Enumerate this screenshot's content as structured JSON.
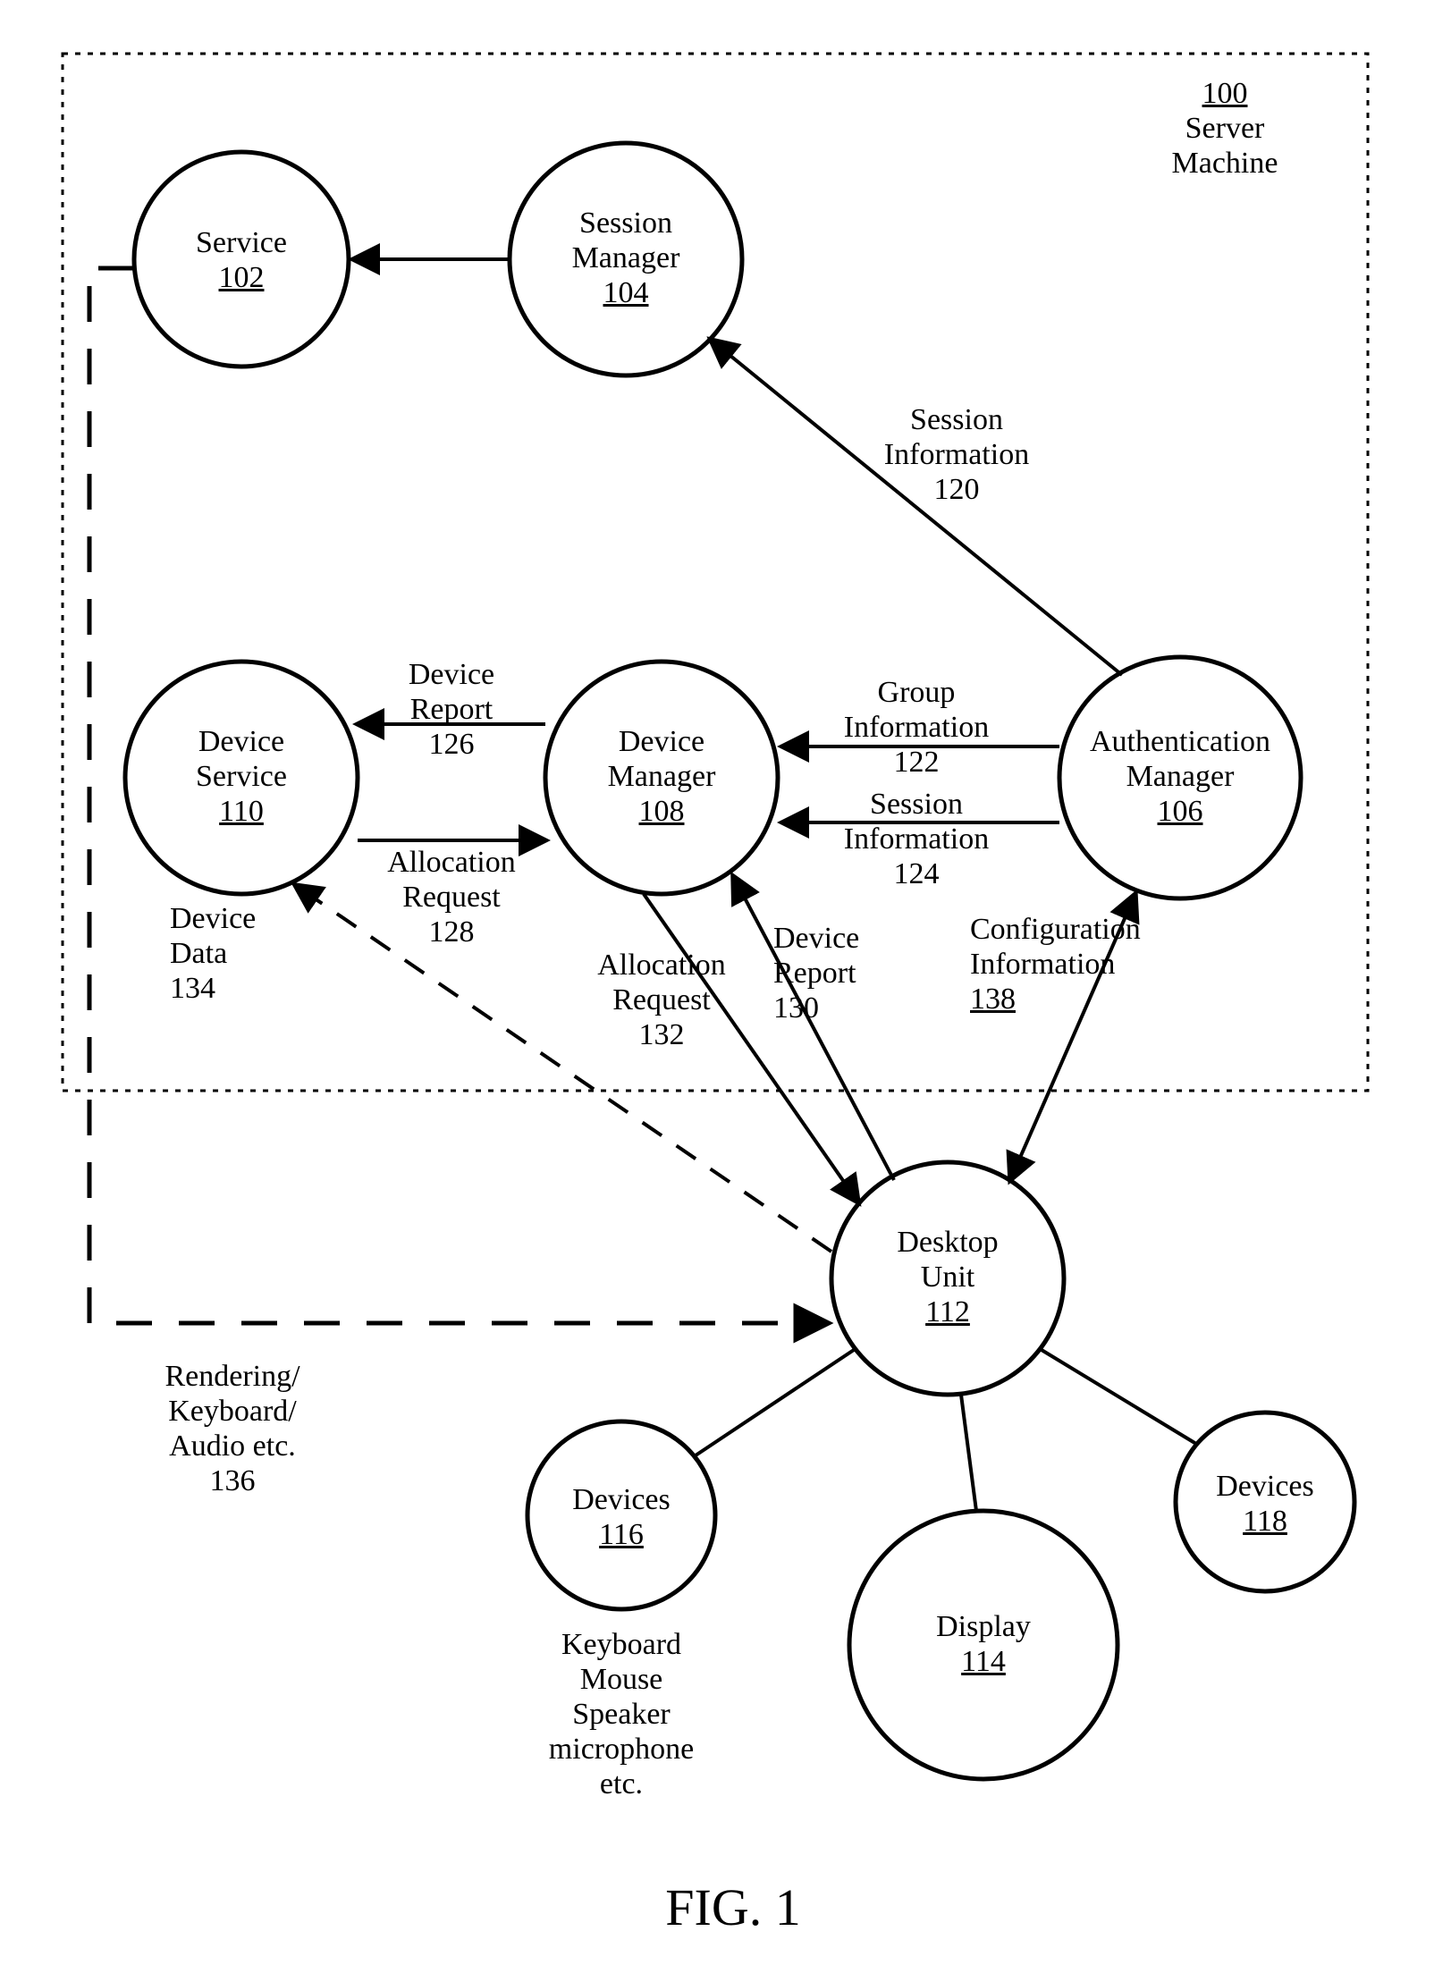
{
  "figure": {
    "label": "FIG. 1"
  },
  "box": {
    "caption_line1": "100",
    "caption_line2": "Server",
    "caption_line3": "Machine"
  },
  "nodes": {
    "service": {
      "name": "Service",
      "ref": "102"
    },
    "sessionMgr": {
      "name1": "Session",
      "name2": "Manager",
      "ref": "104"
    },
    "authMgr": {
      "name1": "Authentication",
      "name2": "Manager",
      "ref": "106"
    },
    "devMgr": {
      "name1": "Device",
      "name2": "Manager",
      "ref": "108"
    },
    "devSvc": {
      "name1": "Device",
      "name2": "Service",
      "ref": "110"
    },
    "desktop": {
      "name1": "Desktop",
      "name2": "Unit",
      "ref": "112"
    },
    "display": {
      "name": "Display",
      "ref": "114"
    },
    "devicesL": {
      "name": "Devices",
      "ref": "116"
    },
    "devicesR": {
      "name": "Devices",
      "ref": "118"
    }
  },
  "edges": {
    "sessInfo120": {
      "l1": "Session",
      "l2": "Information",
      "ref": "120"
    },
    "groupInfo122": {
      "l1": "Group",
      "l2": "Information",
      "ref": "122"
    },
    "sessInfo124": {
      "l1": "Session",
      "l2": "Information",
      "ref": "124"
    },
    "devRep126": {
      "l1": "Device",
      "l2": "Report",
      "ref": "126"
    },
    "allocReq128": {
      "l1": "Allocation",
      "l2": "Request",
      "ref": "128"
    },
    "devRep130": {
      "l1": "Device",
      "l2": "Report",
      "ref": "130"
    },
    "allocReq132": {
      "l1": "Allocation",
      "l2": "Request",
      "ref": "132"
    },
    "devData134": {
      "l1": "Device",
      "l2": "Data",
      "ref": "134"
    },
    "render136": {
      "l1": "Rendering/",
      "l2": "Keyboard/",
      "l3": "Audio etc.",
      "ref": "136"
    },
    "cfg138": {
      "l1": "Configuration",
      "l2": "Information",
      "ref": "138"
    }
  },
  "captions": {
    "devices116": {
      "l1": "Keyboard",
      "l2": "Mouse",
      "l3": "Speaker",
      "l4": "microphone",
      "l5": "etc."
    }
  }
}
